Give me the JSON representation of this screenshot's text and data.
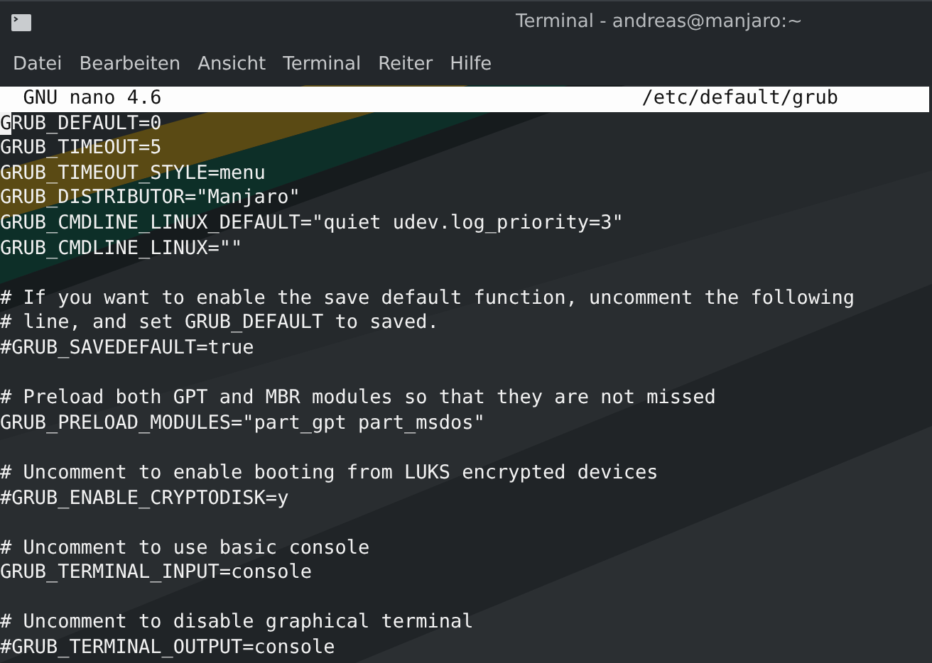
{
  "window": {
    "title": "Terminal - andreas@manjaro:~"
  },
  "menu": [
    "Datei",
    "Bearbeiten",
    "Ansicht",
    "Terminal",
    "Reiter",
    "Hilfe"
  ],
  "nano": {
    "version": "GNU nano 4.6",
    "file": "/etc/default/grub"
  },
  "editor": {
    "cursor_on_first_char": true,
    "blocks": [
      [
        "GRUB_DEFAULT=0",
        "GRUB_TIMEOUT=5",
        "GRUB_TIMEOUT_STYLE=menu",
        "GRUB_DISTRIBUTOR=\"Manjaro\"",
        "GRUB_CMDLINE_LINUX_DEFAULT=\"quiet udev.log_priority=3\"",
        "GRUB_CMDLINE_LINUX=\"\""
      ],
      [
        "# If you want to enable the save default function, uncomment the following",
        "# line, and set GRUB_DEFAULT to saved.",
        "#GRUB_SAVEDEFAULT=true"
      ],
      [
        "# Preload both GPT and MBR modules so that they are not missed",
        "GRUB_PRELOAD_MODULES=\"part_gpt part_msdos\""
      ],
      [
        "# Uncomment to enable booting from LUKS encrypted devices",
        "#GRUB_ENABLE_CRYPTODISK=y"
      ],
      [
        "# Uncomment to use basic console",
        "GRUB_TERMINAL_INPUT=console"
      ],
      [
        "# Uncomment to disable graphical terminal",
        "#GRUB_TERMINAL_OUTPUT=console"
      ]
    ]
  }
}
